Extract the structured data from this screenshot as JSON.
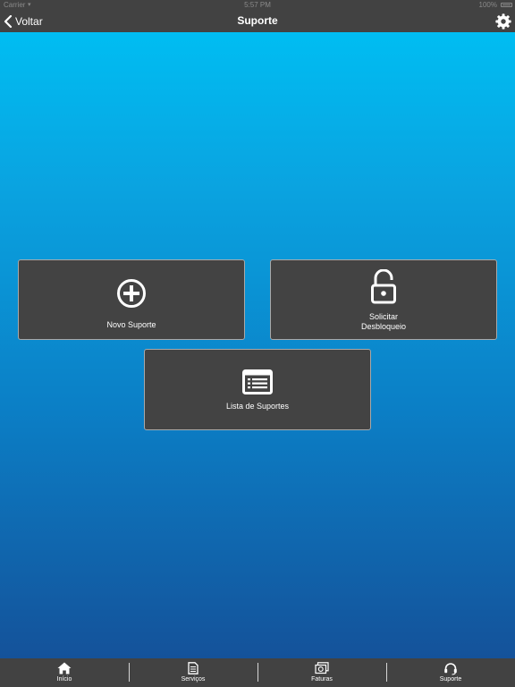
{
  "status_bar": {
    "carrier": "Carrier",
    "time": "5:57 PM",
    "battery": "100%"
  },
  "nav": {
    "back_label": "Voltar",
    "title": "Suporte",
    "settings_icon": "gear-icon",
    "back_icon": "chevron-left-icon"
  },
  "cards": {
    "new_support": {
      "label": "Novo Suporte",
      "icon": "plus-circle-icon"
    },
    "unlock": {
      "label_line1": "Solicitar",
      "label_line2": "Desbloqueio",
      "icon": "unlock-icon"
    },
    "list": {
      "label": "Lista de Suportes",
      "icon": "list-icon"
    }
  },
  "tabs": [
    {
      "label": "Início",
      "icon": "home-icon"
    },
    {
      "label": "Serviços",
      "icon": "document-icon"
    },
    {
      "label": "Faturas",
      "icon": "money-icon"
    },
    {
      "label": "Suporte",
      "icon": "headset-icon"
    }
  ],
  "colors": {
    "bar": "#424242",
    "card": "#434343",
    "gradient_top": "#00bdf2",
    "gradient_bottom": "#14529a"
  }
}
